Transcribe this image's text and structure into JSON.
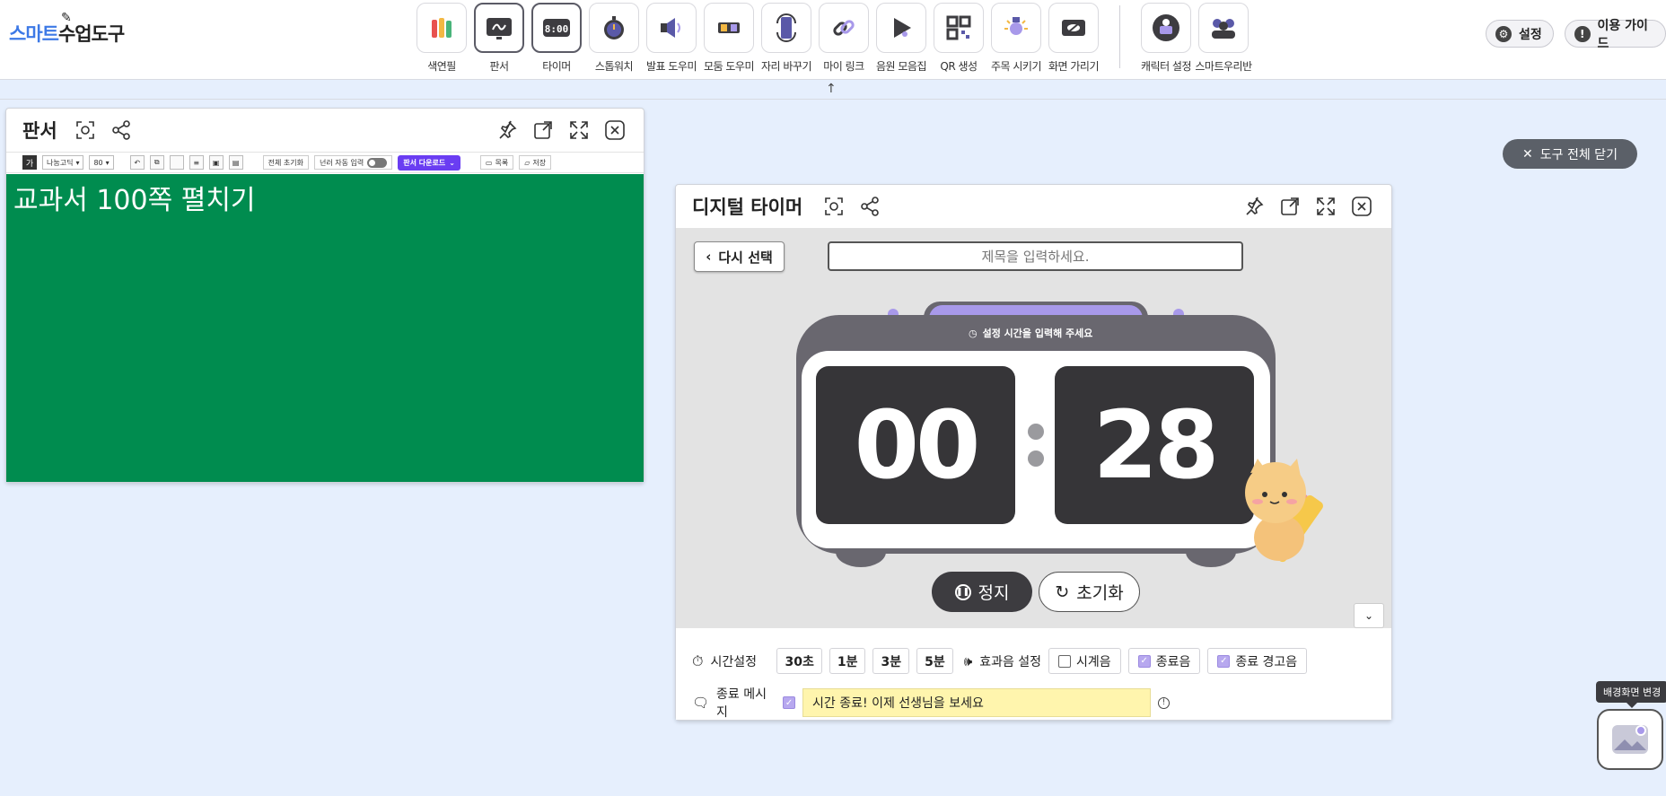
{
  "app": {
    "logo_part1": "스마트",
    "logo_part2": "수업도구"
  },
  "toolbar": {
    "tools": [
      {
        "label": "색연필",
        "icon": "colored-pencils-icon"
      },
      {
        "label": "판서",
        "icon": "board-icon"
      },
      {
        "label": "타이머",
        "icon": "digital-timer-icon"
      },
      {
        "label": "스톱워치",
        "icon": "stopwatch-icon"
      },
      {
        "label": "발표 도우미",
        "icon": "speaker-icon"
      },
      {
        "label": "모둠 도우미",
        "icon": "group-icon"
      },
      {
        "label": "자리 바꾸기",
        "icon": "seat-swap-icon"
      },
      {
        "label": "마이 링크",
        "icon": "link-icon"
      },
      {
        "label": "음원 모음집",
        "icon": "music-icon"
      },
      {
        "label": "QR 생성",
        "icon": "qr-icon"
      },
      {
        "label": "주목 시키기",
        "icon": "spotlight-icon"
      },
      {
        "label": "화면 가리기",
        "icon": "screen-hide-icon"
      }
    ],
    "extra_tools": [
      {
        "label": "캐릭터 설정",
        "icon": "character-icon"
      },
      {
        "label": "스마트우리반",
        "icon": "class-icon"
      }
    ],
    "settings_label": "설정",
    "guide_label": "이용 가이드",
    "collapse_arrow": "↑"
  },
  "board": {
    "title": "판서",
    "font_label": "가",
    "font_name": "나눔고딕",
    "font_size": "80",
    "clear_all": "전체 초기화",
    "auto_input": "넌러 자동 입력",
    "download": "판서 다운로드",
    "list": "목록",
    "save": "저장",
    "content": "교과서 100쪽 펼치기",
    "bg_color": "#008c4f"
  },
  "close_all": {
    "label": "도구 전체 닫기"
  },
  "timer": {
    "title": "디지털 타이머",
    "reselect": "다시 선택",
    "title_placeholder": "제목을 입력하세요.",
    "hint": "설정 시간을 입력해 주세요",
    "minutes": "00",
    "seconds": "28",
    "stop": "정지",
    "reset": "초기화",
    "time_setting_label": "시간설정",
    "presets": [
      "30초",
      "1분",
      "3분",
      "5분"
    ],
    "sound_label": "효과음 설정",
    "sounds": [
      {
        "label": "시계음",
        "checked": false
      },
      {
        "label": "종료음",
        "checked": true
      },
      {
        "label": "종료 경고음",
        "checked": true
      }
    ],
    "end_msg_label": "종료 메시지",
    "end_msg_checked": true,
    "end_msg": "시간 종료! 이제 선생님을 보세요"
  },
  "bg_change": {
    "tooltip": "배경화면 변경"
  },
  "colors": {
    "accent": "#6a3df2",
    "timer_frame": "#69676f",
    "digit_bg": "#363538",
    "lavender": "#a899ea"
  }
}
